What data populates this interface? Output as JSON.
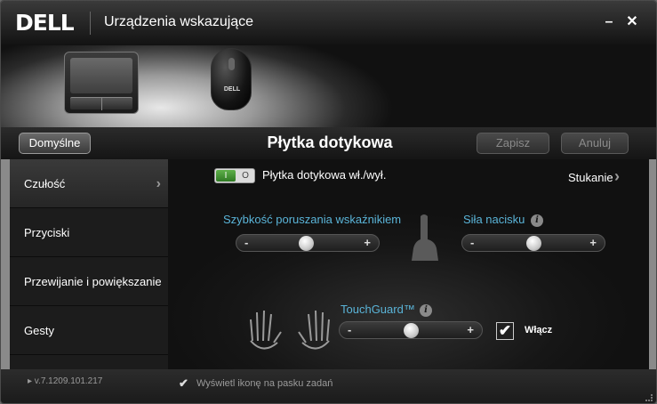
{
  "titlebar": {
    "logo": "DELL",
    "title": "Urządzenia wskazujące",
    "minimize": "–",
    "close": "✕"
  },
  "hero": {
    "mouse_brand": "DELL"
  },
  "toolbar": {
    "default_label": "Domyślne",
    "page_title": "Płytka dotykowa",
    "save_label": "Zapisz",
    "cancel_label": "Anuluj"
  },
  "sidebar": {
    "items": [
      {
        "label": "Czułość",
        "active": true
      },
      {
        "label": "Przyciski",
        "active": false
      },
      {
        "label": "Przewijanie i powiększanie",
        "active": false
      },
      {
        "label": "Gesty",
        "active": false
      }
    ],
    "chevron": "›"
  },
  "main": {
    "toggle_on": "I",
    "toggle_off": "O",
    "toggle_label": "Płytka dotykowa wł./wył.",
    "tap_label": "Stukanie",
    "tap_chevron": "›",
    "pointer_speed": {
      "label": "Szybkość poruszania wskaźnikiem",
      "minus": "-",
      "plus": "+",
      "value": 0.48
    },
    "press_force": {
      "label": "Siła nacisku",
      "minus": "-",
      "plus": "+",
      "value": 0.5
    },
    "touchguard": {
      "label": "TouchGuard™",
      "minus": "-",
      "plus": "+",
      "value": 0.5
    },
    "info_glyph": "i",
    "enable_label": "Włącz",
    "enable_checked": true,
    "check_glyph": "✔"
  },
  "footer": {
    "version": "▸ v.7.1209.101.217",
    "tray_label": "Wyświetl ikonę na pasku zadań",
    "tray_checked": true,
    "check_glyph": "✔"
  },
  "colors": {
    "accent_blue": "#5ab4d8",
    "toggle_green": "#3f9a30"
  }
}
